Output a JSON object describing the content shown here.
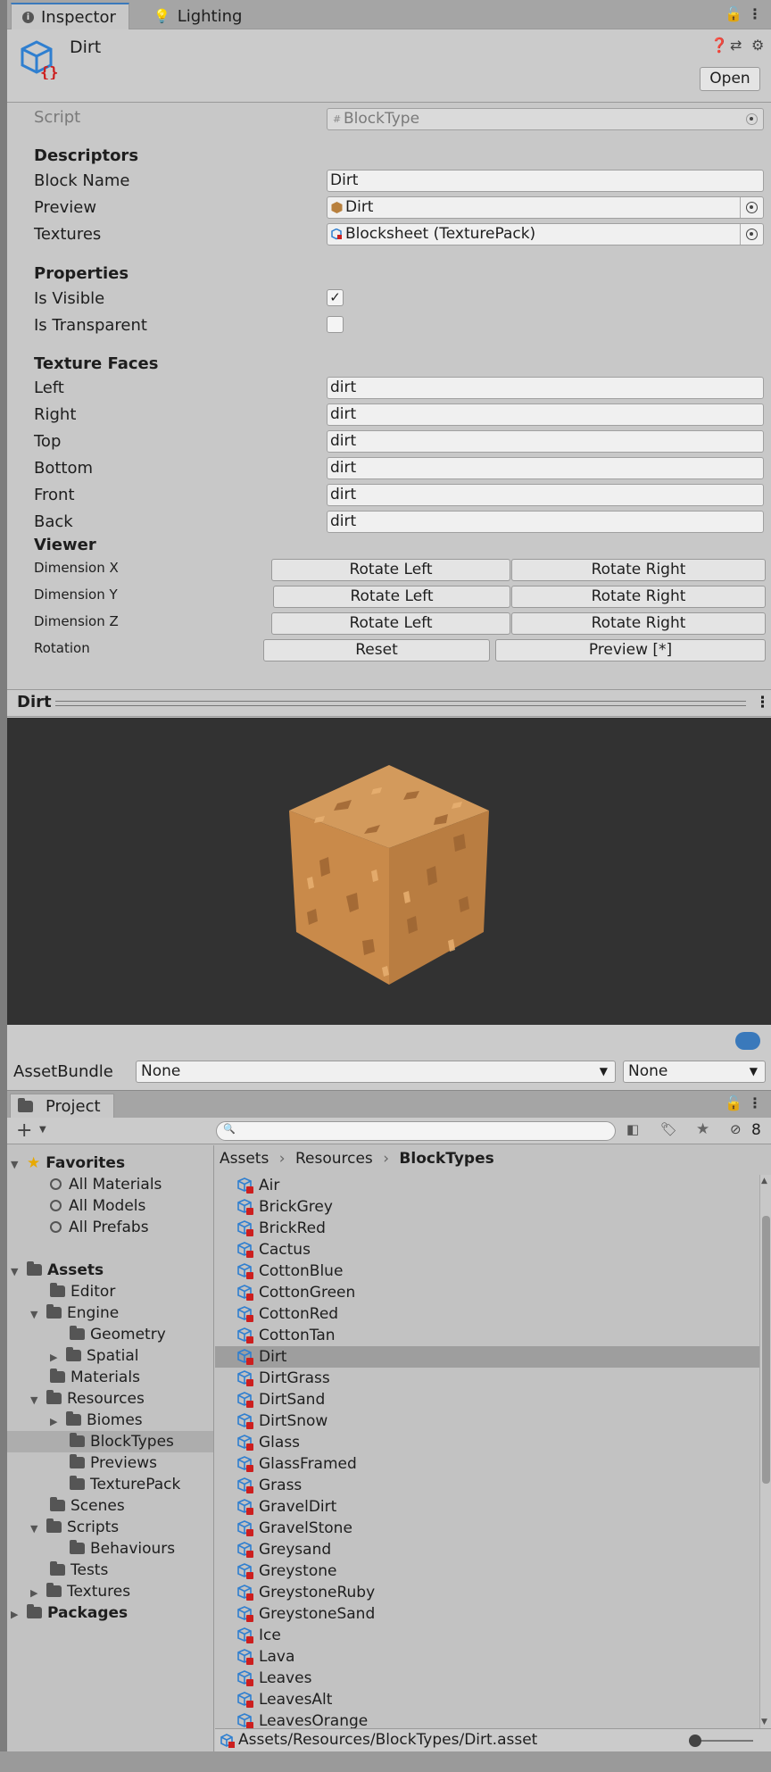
{
  "tabs": {
    "inspector": "Inspector",
    "lighting": "Lighting"
  },
  "asset": {
    "title": "Dirt",
    "open_label": "Open"
  },
  "script": {
    "label": "Script",
    "value": "BlockType"
  },
  "descriptors": {
    "heading": "Descriptors",
    "block_name_label": "Block Name",
    "block_name_value": "Dirt",
    "preview_label": "Preview",
    "preview_value": "Dirt",
    "textures_label": "Textures",
    "textures_value": "Blocksheet (TexturePack)"
  },
  "properties": {
    "heading": "Properties",
    "is_visible_label": "Is Visible",
    "is_visible": true,
    "is_visible_mark": "✓",
    "is_transparent_label": "Is Transparent",
    "is_transparent": false
  },
  "texture_faces": {
    "heading": "Texture Faces",
    "faces": [
      {
        "label": "Left",
        "value": "dirt"
      },
      {
        "label": "Right",
        "value": "dirt"
      },
      {
        "label": "Top",
        "value": "dirt"
      },
      {
        "label": "Bottom",
        "value": "dirt"
      },
      {
        "label": "Front",
        "value": "dirt"
      },
      {
        "label": "Back",
        "value": "dirt"
      }
    ]
  },
  "viewer": {
    "heading": "Viewer",
    "dims": [
      {
        "label": "Dimension X",
        "left": "Rotate Left",
        "right": "Rotate Right"
      },
      {
        "label": "Dimension Y",
        "left": "Rotate Left",
        "right": "Rotate Right"
      },
      {
        "label": "Dimension Z",
        "left": "Rotate Left",
        "right": "Rotate Right"
      }
    ],
    "rotation_label": "Rotation",
    "reset_label": "Reset",
    "preview_label": "Preview [*]"
  },
  "preview_panel": {
    "title": "Dirt"
  },
  "assetbundle": {
    "label": "AssetBundle",
    "name": "None",
    "variant": "None"
  },
  "project": {
    "tab": "Project",
    "hidden_count": "8",
    "breadcrumb": [
      "Assets",
      "Resources",
      "BlockTypes"
    ],
    "tree": [
      {
        "label": "Favorites"
      },
      {
        "label": "All Materials"
      },
      {
        "label": "All Models"
      },
      {
        "label": "All Prefabs"
      },
      {
        "label": "Assets"
      },
      {
        "label": "Editor"
      },
      {
        "label": "Engine"
      },
      {
        "label": "Geometry"
      },
      {
        "label": "Spatial"
      },
      {
        "label": "Materials"
      },
      {
        "label": "Resources"
      },
      {
        "label": "Biomes"
      },
      {
        "label": "BlockTypes"
      },
      {
        "label": "Previews"
      },
      {
        "label": "TexturePack"
      },
      {
        "label": "Scenes"
      },
      {
        "label": "Scripts"
      },
      {
        "label": "Behaviours"
      },
      {
        "label": "Tests"
      },
      {
        "label": "Textures"
      },
      {
        "label": "Packages"
      }
    ],
    "files": [
      "Air",
      "BrickGrey",
      "BrickRed",
      "Cactus",
      "CottonBlue",
      "CottonGreen",
      "CottonRed",
      "CottonTan",
      "Dirt",
      "DirtGrass",
      "DirtSand",
      "DirtSnow",
      "Glass",
      "GlassFramed",
      "Grass",
      "GravelDirt",
      "GravelStone",
      "Greysand",
      "Greystone",
      "GreystoneRuby",
      "GreystoneSand",
      "Ice",
      "Lava",
      "Leaves",
      "LeavesAlt",
      "LeavesOrange"
    ],
    "selected_file": "Dirt",
    "status_path": "Assets/Resources/BlockTypes/Dirt.asset"
  },
  "colors": {
    "accent": "#3a79bb",
    "selection": "#9e9e9e",
    "preview_bg": "#323232",
    "dirt": "#c98a4a"
  }
}
